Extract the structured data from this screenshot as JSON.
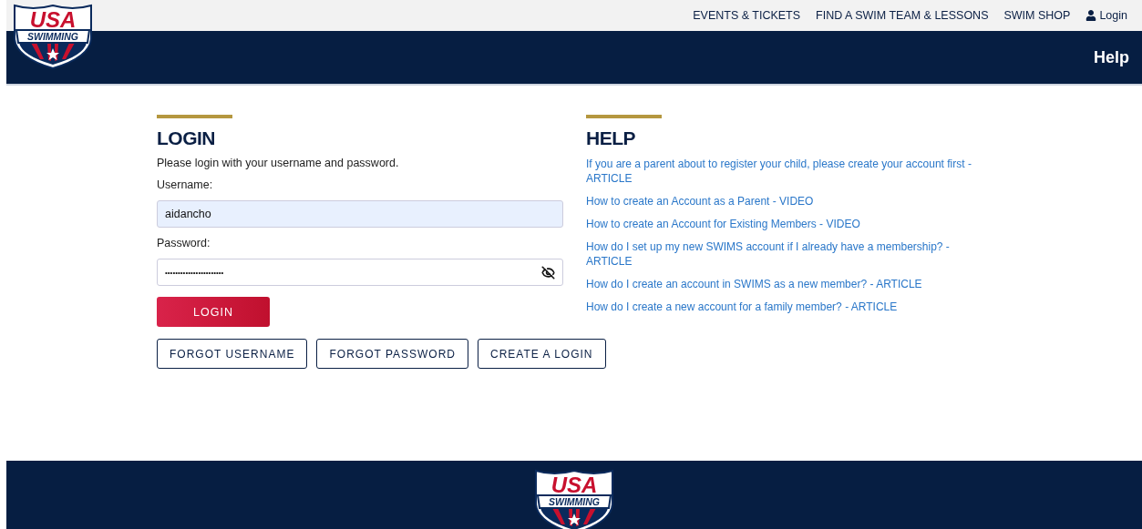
{
  "logo": {
    "top": "USA",
    "bottom": "SWIMMING"
  },
  "top_nav": {
    "links": [
      "EVENTS & TICKETS",
      "FIND A SWIM TEAM & LESSONS",
      "SWIM SHOP"
    ],
    "login": "Login"
  },
  "header": {
    "help_link": "Help"
  },
  "login": {
    "title": "LOGIN",
    "intro": "Please login with your username and password.",
    "username": {
      "label": "Username:",
      "value": "aidancho",
      "autofilled": true
    },
    "password": {
      "label": "Password:",
      "value": "•••••••••••••••••••••••"
    },
    "submit": "LOGIN",
    "buttons": [
      "FORGOT USERNAME",
      "FORGOT PASSWORD",
      "CREATE A LOGIN"
    ]
  },
  "help": {
    "title": "HELP",
    "links": [
      "If you are a parent about to register your child, please create your account first - ARTICLE",
      "How to create an Account as a Parent - VIDEO",
      "How to create an Account for Existing Members - VIDEO",
      "How do I set up my new SWIMS account if I already have a membership? - ARTICLE",
      "How do I create an account in SWIMS as a new member? - ARTICLE",
      "How do I create a new account for a family member? - ARTICLE"
    ]
  },
  "footer": {
    "logo": {
      "top": "USA",
      "bottom": "SWIMMING"
    }
  }
}
